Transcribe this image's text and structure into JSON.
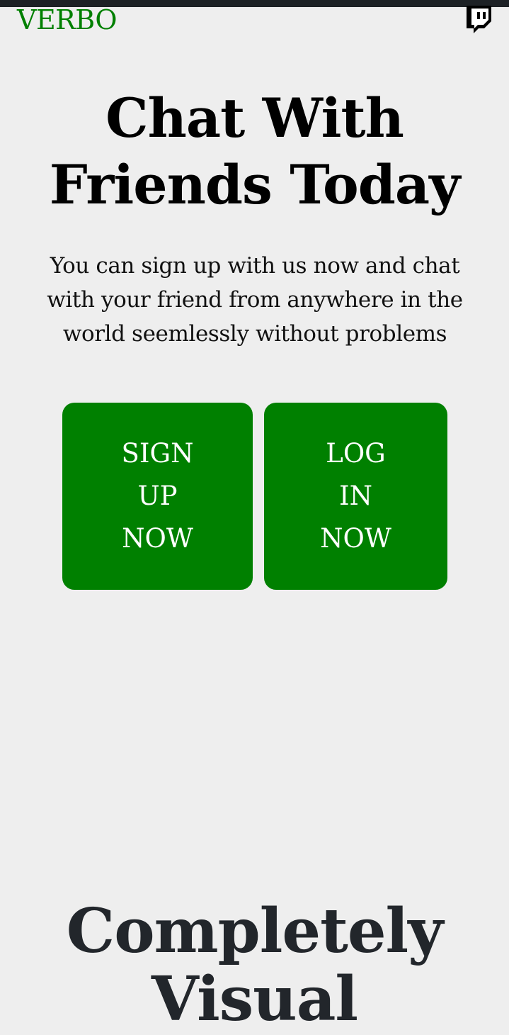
{
  "header": {
    "brand": "VERBO",
    "brand_color": "#008000",
    "social_icon": "twitch-icon"
  },
  "hero": {
    "title": "Chat With Friends Today",
    "subtitle": "You can sign up with us now and chat with your friend from anywhere in the world seemlessly without problems"
  },
  "actions": {
    "signup_label": "SIGN UP NOW",
    "login_label": "LOG IN NOW",
    "button_color": "#008000"
  },
  "features": {
    "title": "Completely Visual"
  }
}
